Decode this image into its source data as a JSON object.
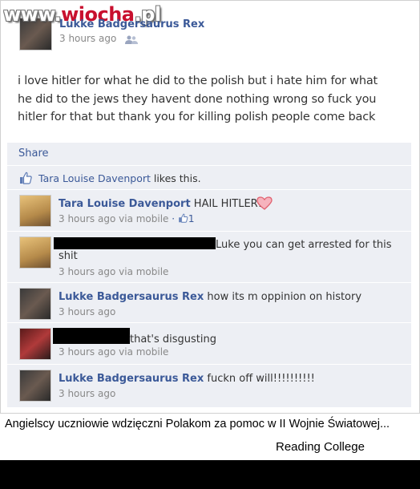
{
  "watermark": {
    "prefix": "www.",
    "accent": "wiocha",
    "suffix": ".pl"
  },
  "post": {
    "author": "Lukke Badgersaurus Rex",
    "time": "3 hours ago",
    "body": "i love hitler for what he did to the polish but i hate him for what he did to the jews they havent done nothing wrong so fuck you hitler for that but thank you for killing polish people come back"
  },
  "actions": {
    "share": "Share"
  },
  "likes": {
    "name": "Tara Louise Davenport",
    "suffix": " likes this."
  },
  "comments": [
    {
      "author": "Tara Louise Davenport",
      "text": " HAIL HITLER! ",
      "time": "3 hours ago via mobile",
      "like_count": "1"
    },
    {
      "author": "",
      "text": "Luke you can get arrested for this",
      "text2": "shit",
      "time": "3 hours ago via mobile"
    },
    {
      "author": "Lukke Badgersaurus Rex",
      "text": " how its m oppinion on history",
      "time": "3 hours ago"
    },
    {
      "author": "",
      "text": "that's disgusting",
      "time": "3 hours ago via mobile"
    },
    {
      "author": "Lukke Badgersaurus Rex",
      "text": " fuckn off will!!!!!!!!!!",
      "time": "3 hours ago"
    }
  ],
  "caption": {
    "text": "Angielscy uczniowie wdzięczni Polakom za pomoc w II Wojnie Światowej...",
    "college": "Reading College"
  },
  "colors": {
    "link": "#3b5998",
    "panel": "#edeff4",
    "heart": "#e0606e"
  },
  "icons": [
    "people-icon",
    "thumb-up-icon",
    "heart-icon"
  ]
}
